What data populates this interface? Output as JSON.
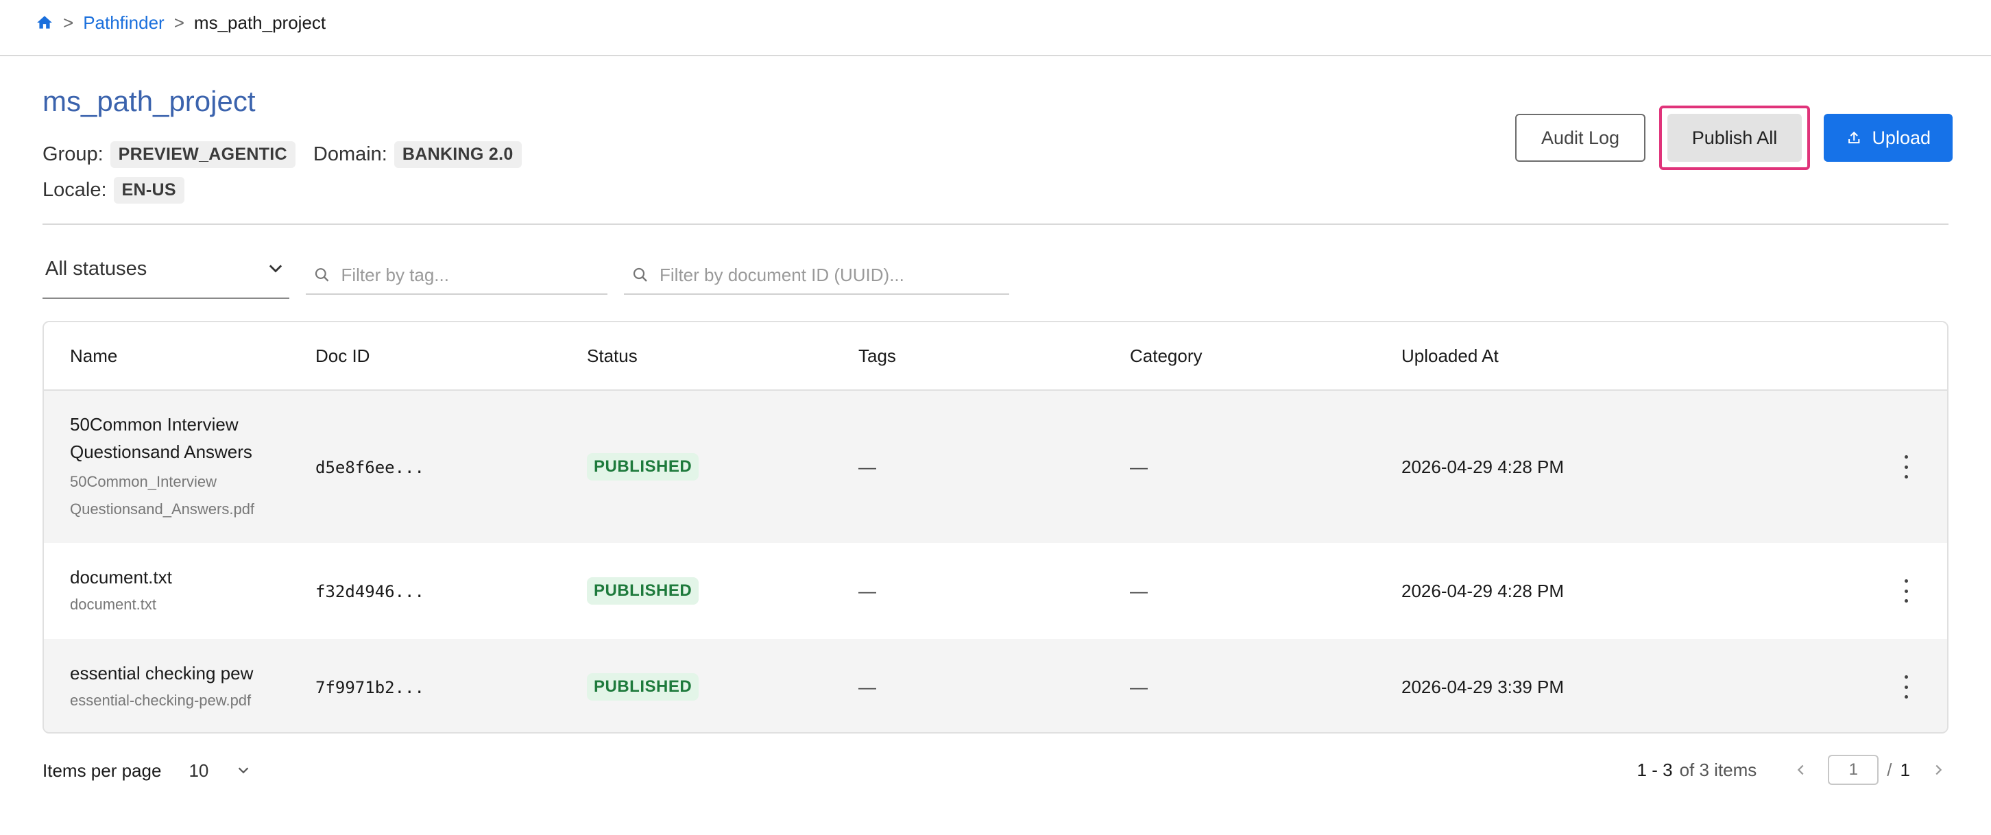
{
  "breadcrumb": {
    "home_icon": "home-icon",
    "items": [
      "Pathfinder",
      "ms_path_project"
    ],
    "separator": ">"
  },
  "header": {
    "title": "ms_path_project",
    "group_label": "Group:",
    "group_value": "PREVIEW_AGENTIC",
    "domain_label": "Domain:",
    "domain_value": "BANKING 2.0",
    "locale_label": "Locale:",
    "locale_value": "EN-US"
  },
  "actions": {
    "audit_log": "Audit Log",
    "publish_all": "Publish All",
    "upload": "Upload",
    "highlight_color": "#e0337a",
    "primary_color": "#1672e8"
  },
  "filters": {
    "status_selected": "All statuses",
    "tag_placeholder": "Filter by tag...",
    "docid_placeholder": "Filter by document ID (UUID)..."
  },
  "table": {
    "columns": [
      "Name",
      "Doc ID",
      "Status",
      "Tags",
      "Category",
      "Uploaded At"
    ],
    "rows": [
      {
        "name": "50Common Interview Questionsand Answers",
        "file": "50Common_Interview Questionsand_Answers.pdf",
        "doc_id": "d5e8f6ee...",
        "status": "PUBLISHED",
        "tags": "—",
        "category": "—",
        "uploaded_at": "2026-04-29 4:28 PM"
      },
      {
        "name": "document.txt",
        "file": "document.txt",
        "doc_id": "f32d4946...",
        "status": "PUBLISHED",
        "tags": "—",
        "category": "—",
        "uploaded_at": "2026-04-29 4:28 PM"
      },
      {
        "name": "essential checking pew",
        "file": "essential-checking-pew.pdf",
        "doc_id": "7f9971b2...",
        "status": "PUBLISHED",
        "tags": "—",
        "category": "—",
        "uploaded_at": "2026-04-29 3:39 PM"
      }
    ]
  },
  "pagination": {
    "items_per_page_label": "Items per page",
    "items_per_page_value": "10",
    "range": "1 - 3",
    "of_items": "of 3 items",
    "current_page": "1",
    "slash": "/",
    "total_pages": "1"
  }
}
